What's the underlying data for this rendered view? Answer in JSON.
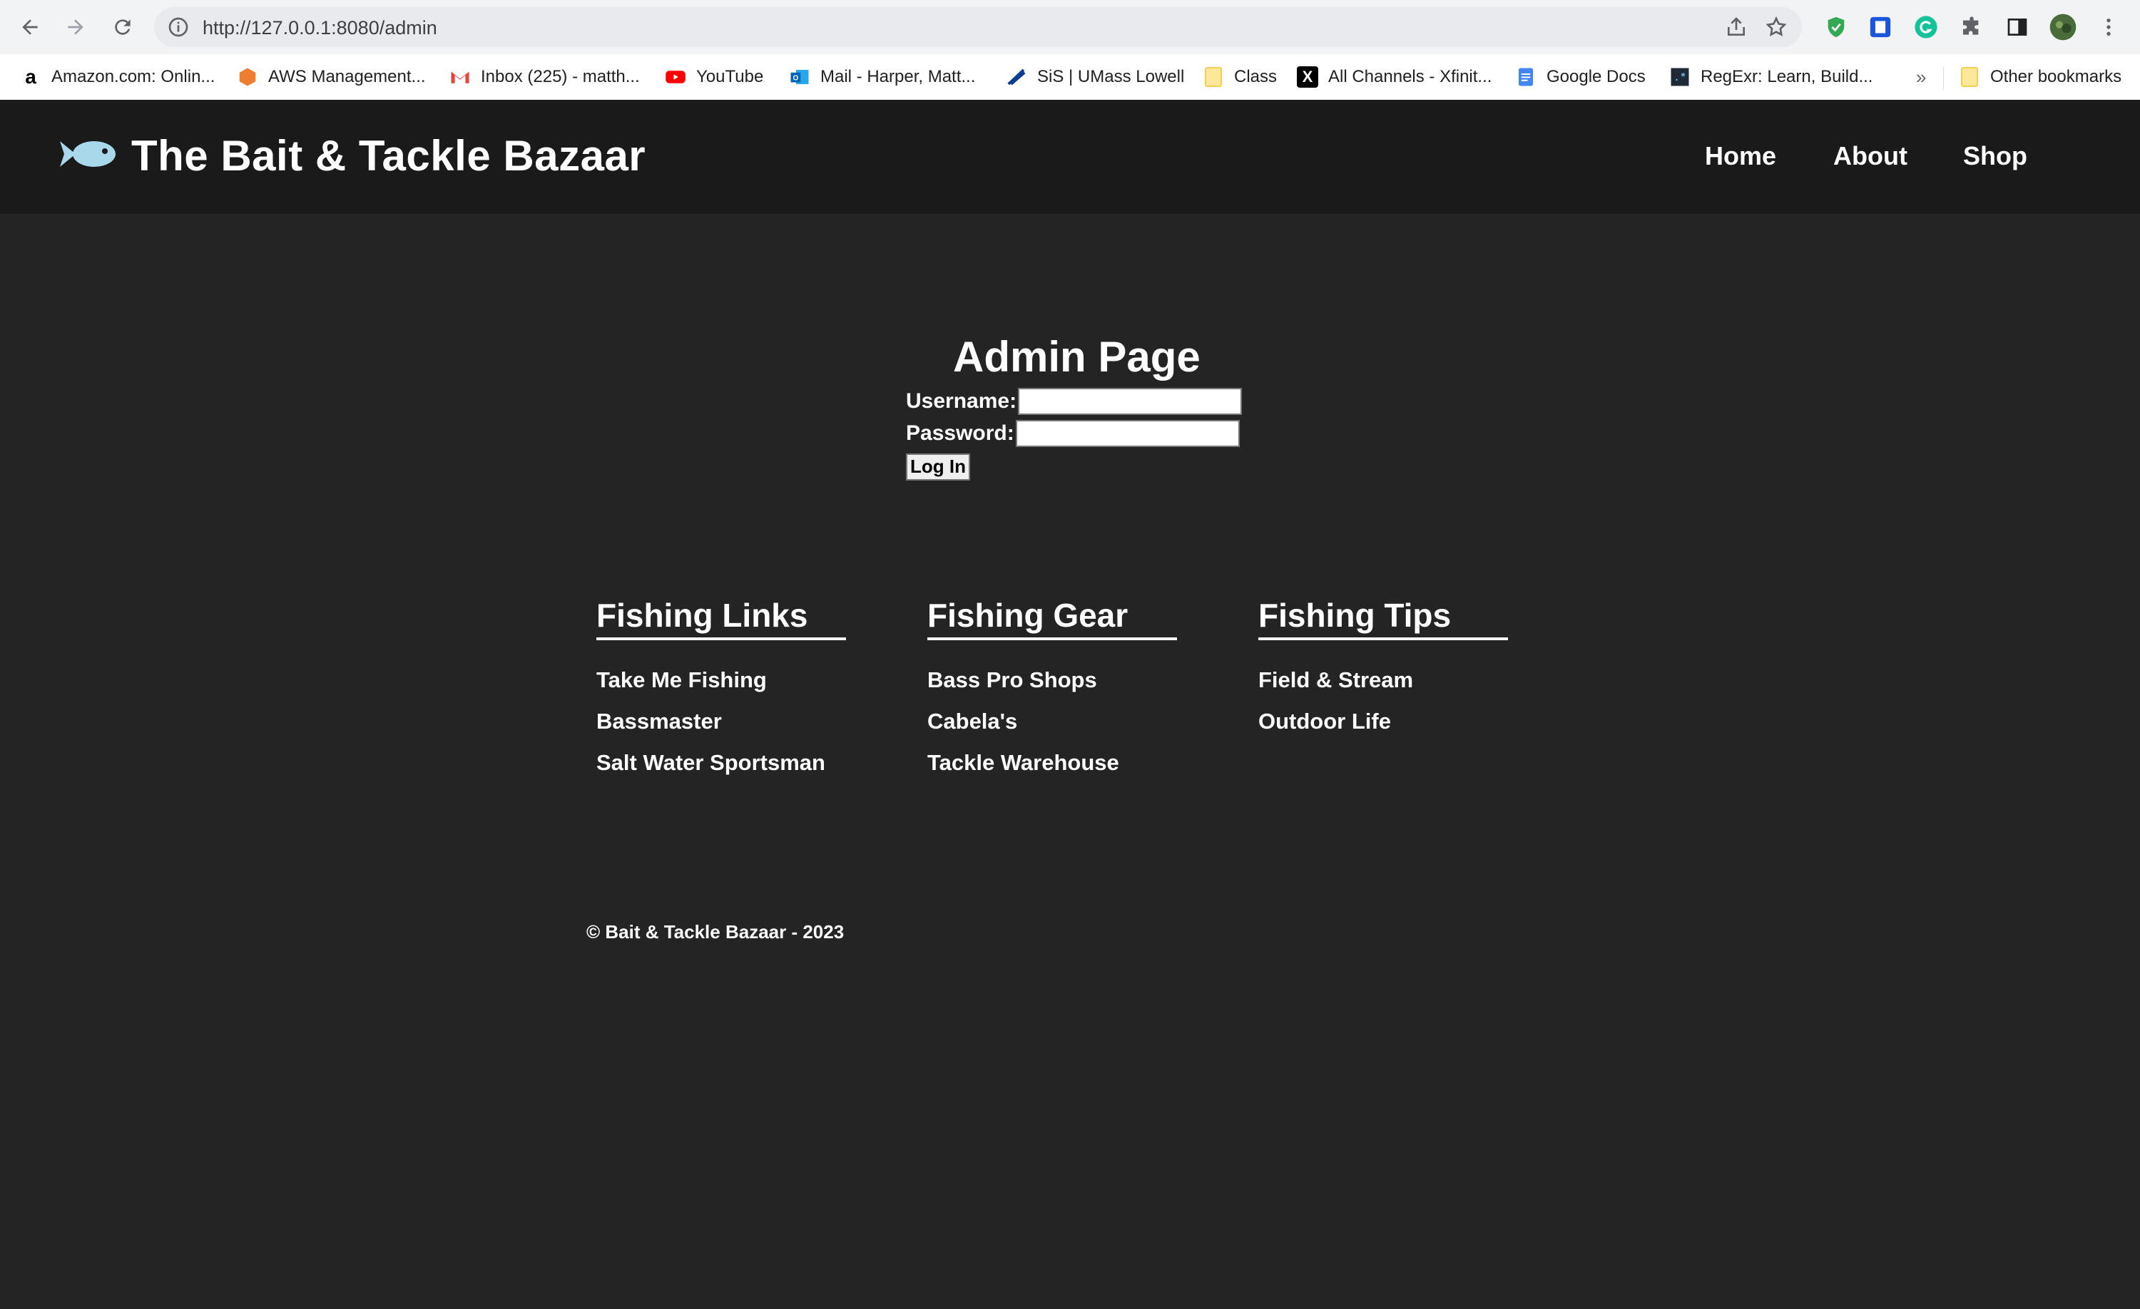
{
  "browser": {
    "url": "http://127.0.0.1:8080/admin",
    "bookmarks": [
      {
        "label": "Amazon.com: Onlin...",
        "icon": "amazon-icon"
      },
      {
        "label": "AWS Management...",
        "icon": "aws-icon"
      },
      {
        "label": "Inbox (225) - matth...",
        "icon": "gmail-icon"
      },
      {
        "label": "YouTube",
        "icon": "youtube-icon"
      },
      {
        "label": "Mail - Harper, Matt...",
        "icon": "outlook-icon"
      },
      {
        "label": "SiS | UMass Lowell",
        "icon": "umass-icon"
      },
      {
        "label": "Class",
        "icon": "folder-icon"
      },
      {
        "label": "All Channels - Xfinit...",
        "icon": "xfinity-icon"
      },
      {
        "label": "Google Docs",
        "icon": "google-docs-icon"
      },
      {
        "label": "RegExr: Learn, Build...",
        "icon": "regexr-icon"
      }
    ],
    "overflow_label": "»",
    "other_bookmarks": "Other bookmarks"
  },
  "site": {
    "title": "The Bait & Tackle Bazaar",
    "accent": "#a8d8ea",
    "nav": [
      "Home",
      "About",
      "Shop"
    ]
  },
  "admin": {
    "heading": "Admin Page",
    "username_label": "Username:",
    "password_label": "Password:",
    "login_label": "Log In"
  },
  "footer": {
    "columns": [
      {
        "title": "Fishing Links",
        "links": [
          "Take Me Fishing",
          "Bassmaster",
          "Salt Water Sportsman"
        ]
      },
      {
        "title": "Fishing Gear",
        "links": [
          "Bass Pro Shops",
          "Cabela's",
          "Tackle Warehouse"
        ]
      },
      {
        "title": "Fishing Tips",
        "links": [
          "Field & Stream",
          "Outdoor Life"
        ]
      }
    ],
    "copyright": "© Bait & Tackle Bazaar - 2023"
  }
}
